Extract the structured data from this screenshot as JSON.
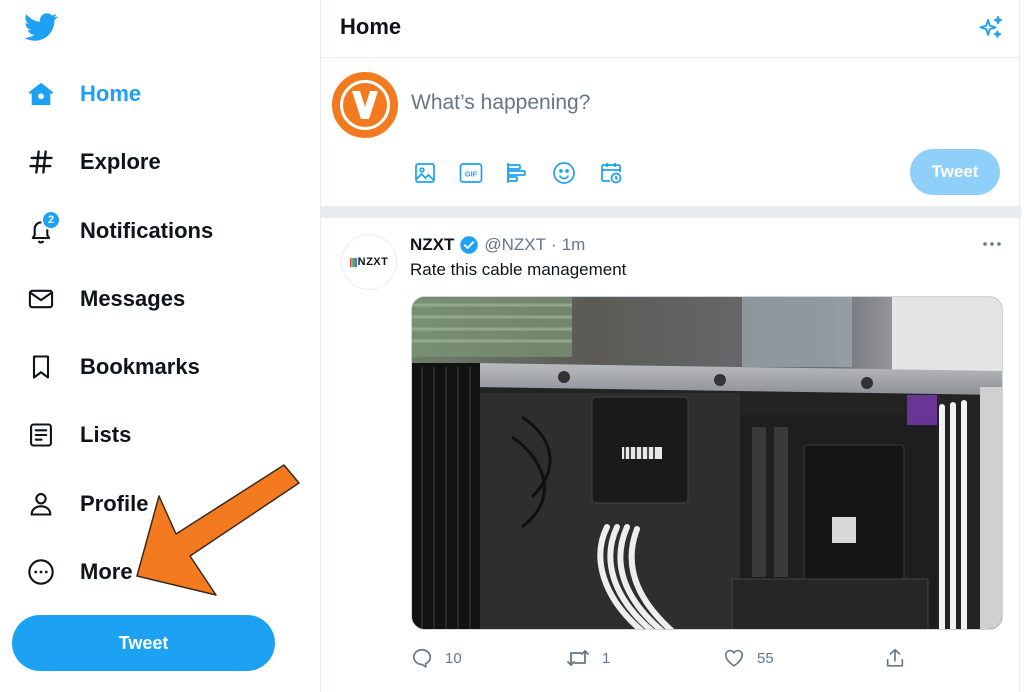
{
  "sidebar": {
    "logo_icon": "twitter-bird-icon",
    "items": [
      {
        "label": "Home",
        "icon": "home-icon",
        "active": true
      },
      {
        "label": "Explore",
        "icon": "hashtag-icon"
      },
      {
        "label": "Notifications",
        "icon": "bell-icon",
        "badge": "2"
      },
      {
        "label": "Messages",
        "icon": "envelope-icon"
      },
      {
        "label": "Bookmarks",
        "icon": "bookmark-icon"
      },
      {
        "label": "Lists",
        "icon": "list-icon"
      },
      {
        "label": "Profile",
        "icon": "person-icon"
      },
      {
        "label": "More",
        "icon": "more-circle-icon"
      }
    ],
    "tweet_button": "Tweet"
  },
  "header": {
    "title": "Home",
    "sparkle_icon": "sparkle-icon"
  },
  "compose": {
    "placeholder": "What’s happening?",
    "tools": [
      "image-icon",
      "gif-icon",
      "poll-icon",
      "emoji-icon",
      "schedule-icon"
    ],
    "tweet_button": "Tweet"
  },
  "tweet": {
    "avatar_text": "NZXT",
    "name": "NZXT",
    "handle": "@NZXT",
    "separator": "·",
    "time": "1m",
    "text": "Rate this cable management",
    "replies": "10",
    "retweets": "1",
    "likes": "55"
  },
  "annotation": {
    "arrow_color": "#f47a20"
  },
  "colors": {
    "accent": "#1da1f2",
    "accent_disabled": "#8ed0f9",
    "text": "#0f1419",
    "secondary_text": "#657786",
    "border": "#e6ecf0"
  }
}
